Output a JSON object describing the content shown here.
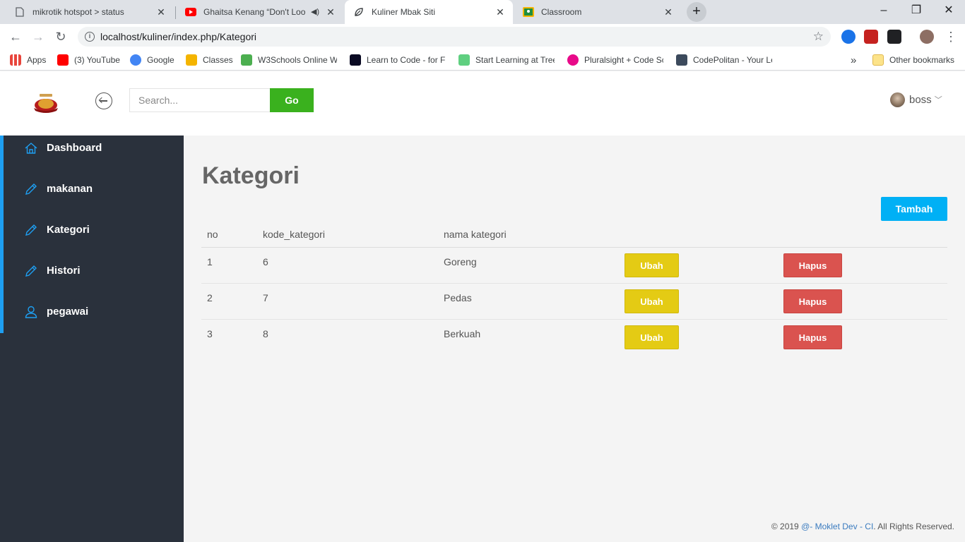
{
  "browser": {
    "tabs": [
      {
        "title": "mikrotik hotspot > status",
        "icon": "document-icon"
      },
      {
        "title": "Ghaitsa Kenang “Don't Look",
        "icon": "youtube-icon"
      },
      {
        "title": "Kuliner Mbak Siti",
        "icon": "leaf-icon"
      },
      {
        "title": "Classroom",
        "icon": "classroom-icon"
      }
    ],
    "new_tab": "+",
    "controls": {
      "minimize": "–",
      "maximize": "❐",
      "close": "✕"
    },
    "url": "localhost/kuliner/index.php/Kategori",
    "bookmarks": [
      {
        "label": "Apps",
        "color": "#e8453c"
      },
      {
        "label": "(3) YouTube",
        "color": "#ff0000"
      },
      {
        "label": "Google",
        "color": "#4285f4"
      },
      {
        "label": "Classes",
        "color": "#f4b400"
      },
      {
        "label": "W3Schools Online W",
        "color": "#4caf50"
      },
      {
        "label": "Learn to Code - for Fr",
        "color": "#0a0a23"
      },
      {
        "label": "Start Learning at Tree",
        "color": "#5fcf80"
      },
      {
        "label": "Pluralsight + Code Sc",
        "color": "#e80a89"
      },
      {
        "label": "CodePolitan - Your Le",
        "color": "#3c4a5c"
      }
    ],
    "bookmarks_more": "»",
    "other_bookmarks": "Other bookmarks"
  },
  "header": {
    "search_placeholder": "Search...",
    "go_label": "Go",
    "user_name": "boss"
  },
  "sidebar": {
    "accent": "#1e9ff2",
    "items": [
      {
        "label": "Dashboard",
        "icon": "home-icon"
      },
      {
        "label": "makanan",
        "icon": "pencil-icon"
      },
      {
        "label": "Kategori",
        "icon": "pencil-icon"
      },
      {
        "label": "Histori",
        "icon": "pencil-icon"
      },
      {
        "label": "pegawai",
        "icon": "user-icon"
      }
    ]
  },
  "main": {
    "title": "Kategori",
    "add_label": "Tambah",
    "columns": [
      "no",
      "kode_kategori",
      "nama kategori"
    ],
    "rows": [
      {
        "no": "1",
        "kode": "6",
        "nama": "Goreng",
        "edit": "Ubah",
        "delete": "Hapus"
      },
      {
        "no": "2",
        "kode": "7",
        "nama": "Pedas",
        "edit": "Ubah",
        "delete": "Hapus"
      },
      {
        "no": "3",
        "kode": "8",
        "nama": "Berkuah",
        "edit": "Ubah",
        "delete": "Hapus"
      }
    ]
  },
  "footer": {
    "prefix": "© 2019 ",
    "link": "@- Moklet Dev - CI",
    "suffix": ". All Rights Reserved."
  },
  "colors": {
    "go_button": "#3ab11e",
    "add_button": "#00b0f5",
    "edit_button": "#e4cb14",
    "delete_button": "#da534f",
    "sidebar_bg": "#2a313c"
  }
}
